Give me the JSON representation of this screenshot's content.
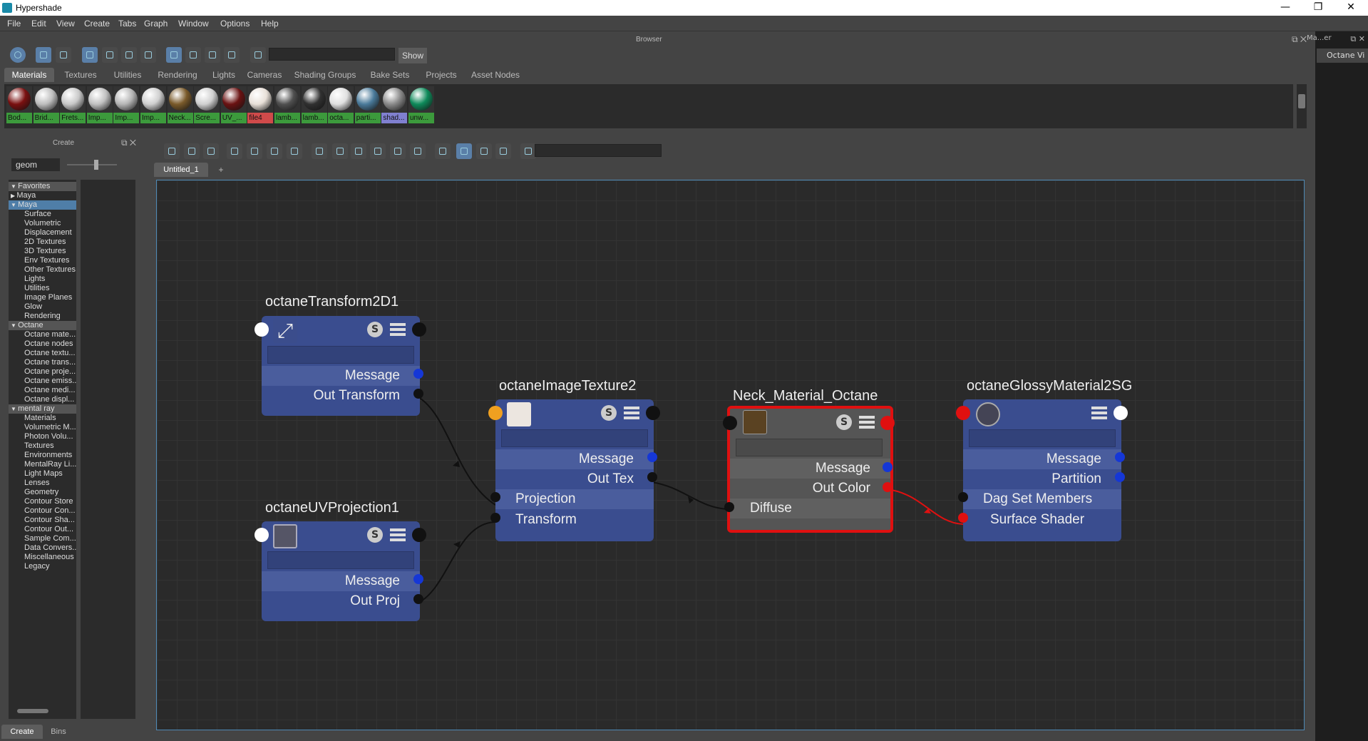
{
  "window": {
    "title": "Hypershade"
  },
  "menu": [
    "File",
    "Edit",
    "View",
    "Create",
    "Tabs",
    "Graph",
    "Window",
    "Options",
    "Help"
  ],
  "browser": {
    "title": "Browser",
    "show_label": "Show",
    "tabs": [
      "Materials",
      "Textures",
      "Utilities",
      "Rendering",
      "Lights",
      "Cameras",
      "Shading Groups",
      "Bake Sets",
      "Projects",
      "Asset Nodes"
    ],
    "swatches": [
      {
        "label": "Bod...",
        "color": "#7a1010",
        "labelbg": "#3c9a3c"
      },
      {
        "label": "Brid...",
        "color": "#bdbdbd",
        "labelbg": "#3c9a3c"
      },
      {
        "label": "Frets...",
        "color": "#c8c8c8",
        "labelbg": "#3c9a3c"
      },
      {
        "label": "Imp...",
        "color": "#c0c0c0",
        "labelbg": "#3c9a3c"
      },
      {
        "label": "Imp...",
        "color": "#b5b5b5",
        "labelbg": "#3c9a3c"
      },
      {
        "label": "Imp...",
        "color": "#cfcfcf",
        "labelbg": "#3c9a3c"
      },
      {
        "label": "Neck...",
        "color": "#7a5a2a",
        "labelbg": "#3c9a3c"
      },
      {
        "label": "Scre...",
        "color": "#d0d0d0",
        "labelbg": "#3c9a3c"
      },
      {
        "label": "UV_...",
        "color": "#6a1212",
        "labelbg": "#3c9a3c"
      },
      {
        "label": "file4",
        "color": "#e8e0d8",
        "labelbg": "#d04a4a"
      },
      {
        "label": "lamb...",
        "color": "#505050",
        "labelbg": "#3c9a3c"
      },
      {
        "label": "lamb...",
        "color": "#303030",
        "labelbg": "#3c9a3c"
      },
      {
        "label": "octa...",
        "color": "#e0e0e0",
        "labelbg": "#3c9a3c"
      },
      {
        "label": "parti...",
        "color": "#4a7a9a",
        "labelbg": "#3c9a3c"
      },
      {
        "label": "shad...",
        "color": "#8a8a8a",
        "labelbg": "#8080d0"
      },
      {
        "label": "unw...",
        "color": "#0e8a5a",
        "labelbg": "#3c9a3c"
      }
    ]
  },
  "create": {
    "title": "Create",
    "search": "geom",
    "tree": [
      {
        "label": "Favorites",
        "hdr": true,
        "arrow": "▼"
      },
      {
        "label": "Maya",
        "hdr": false,
        "arrow": "▶"
      },
      {
        "label": "Maya",
        "hdr": true,
        "sel": true,
        "arrow": "▼"
      },
      {
        "label": "Surface"
      },
      {
        "label": "Volumetric"
      },
      {
        "label": "Displacement"
      },
      {
        "label": "2D Textures"
      },
      {
        "label": "3D Textures"
      },
      {
        "label": "Env Textures"
      },
      {
        "label": "Other Textures"
      },
      {
        "label": "Lights"
      },
      {
        "label": "Utilities"
      },
      {
        "label": "Image Planes"
      },
      {
        "label": "Glow"
      },
      {
        "label": "Rendering"
      },
      {
        "label": "Octane",
        "hdr": true,
        "arrow": "▼"
      },
      {
        "label": "Octane mate..."
      },
      {
        "label": "Octane nodes"
      },
      {
        "label": "Octane textu..."
      },
      {
        "label": "Octane trans..."
      },
      {
        "label": "Octane proje..."
      },
      {
        "label": "Octane emiss..."
      },
      {
        "label": "Octane medi..."
      },
      {
        "label": "Octane displ..."
      },
      {
        "label": "mental ray",
        "hdr": true,
        "arrow": "▼"
      },
      {
        "label": "Materials"
      },
      {
        "label": "Volumetric M..."
      },
      {
        "label": "Photon Volu..."
      },
      {
        "label": "Textures"
      },
      {
        "label": "Environments"
      },
      {
        "label": "MentalRay Li..."
      },
      {
        "label": "Light Maps"
      },
      {
        "label": "Lenses"
      },
      {
        "label": "Geometry"
      },
      {
        "label": "Contour Store"
      },
      {
        "label": "Contour Con..."
      },
      {
        "label": "Contour Sha..."
      },
      {
        "label": "Contour Out..."
      },
      {
        "label": "Sample Com..."
      },
      {
        "label": "Data Convers..."
      },
      {
        "label": "Miscellaneous"
      },
      {
        "label": "Legacy"
      }
    ],
    "bottom_tabs": [
      "Create",
      "Bins"
    ]
  },
  "editor": {
    "tab": "Untitled_1",
    "add_tab": "+"
  },
  "right": {
    "title": "Ma...er",
    "tab": "Octane Vi"
  },
  "nodes": {
    "t2d": {
      "title": "octaneTransform2D1",
      "rows": [
        "Message",
        "Out Transform"
      ]
    },
    "uvp": {
      "title": "octaneUVProjection1",
      "rows": [
        "Message",
        "Out Proj"
      ]
    },
    "img": {
      "title": "octaneImageTexture2",
      "rows": [
        "Message",
        "Out Tex",
        "Projection",
        "Transform"
      ]
    },
    "neck": {
      "title": "Neck_Material_Octane",
      "rows": [
        "Message",
        "Out Color",
        "Diffuse"
      ]
    },
    "sg": {
      "title": "octaneGlossyMaterial2SG",
      "rows": [
        "Message",
        "Partition",
        "Dag Set Members",
        "Surface Shader"
      ]
    }
  },
  "colors": {
    "accent": "#5a7fa8",
    "port_blue": "#1537d6",
    "port_red": "#e01010",
    "port_orange": "#f0a020",
    "node_blue": "#3a4d8f",
    "node_gray": "#555555",
    "selected": "#e01010"
  }
}
